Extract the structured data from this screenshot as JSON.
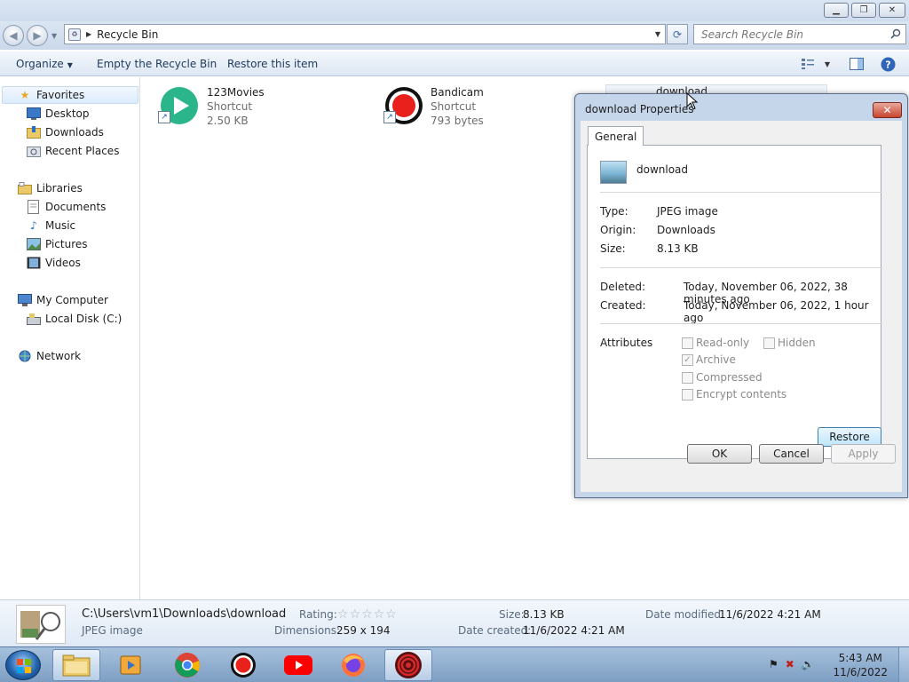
{
  "window": {
    "controls": {
      "minimize": "▁",
      "restore": "❐",
      "close": "✕"
    }
  },
  "address": {
    "path": "Recycle Bin",
    "search_placeholder": "Search Recycle Bin"
  },
  "toolbar": {
    "organize": "Organize",
    "empty": "Empty the Recycle Bin",
    "restore": "Restore this item"
  },
  "nav": {
    "favorites": "Favorites",
    "desktop": "Desktop",
    "downloads": "Downloads",
    "recent": "Recent Places",
    "libraries": "Libraries",
    "documents": "Documents",
    "music": "Music",
    "pictures": "Pictures",
    "videos": "Videos",
    "computer": "My Computer",
    "localdisk": "Local Disk (C:)",
    "network": "Network"
  },
  "files": [
    {
      "name": "123Movies",
      "type": "Shortcut",
      "size": "2.50 KB"
    },
    {
      "name": "Bandicam",
      "type": "Shortcut",
      "size": "793 bytes"
    },
    {
      "name": "download"
    }
  ],
  "dialog": {
    "title": "download Properties",
    "close": "✕",
    "tab": "General",
    "filename": "download",
    "type_label": "Type:",
    "type_value": "JPEG image",
    "origin_label": "Origin:",
    "origin_value": "Downloads",
    "size_label": "Size:",
    "size_value": "8.13 KB",
    "deleted_label": "Deleted:",
    "deleted_value": "Today, November 06, 2022, 38 minutes ago",
    "created_label": "Created:",
    "created_value": "Today, November 06, 2022, 1 hour ago",
    "attributes_label": "Attributes",
    "attr": {
      "readonly": "Read-only",
      "hidden": "Hidden",
      "archive": "Archive",
      "compressed": "Compressed",
      "encrypt": "Encrypt contents"
    },
    "restore": "Restore",
    "ok": "OK",
    "cancel": "Cancel",
    "apply": "Apply"
  },
  "details": {
    "path": "C:\\Users\\vm1\\Downloads\\download",
    "type": "JPEG image",
    "rating_label": "Rating:",
    "rating": 0,
    "dimensions_label": "Dimensions:",
    "dimensions": "259 x 194",
    "size_label": "Size:",
    "size": "8.13 KB",
    "created_label": "Date created:",
    "created": "11/6/2022 4:21 AM",
    "modified_label": "Date modified:",
    "modified": "11/6/2022 4:21 AM"
  },
  "taskbar": {
    "time": "5:43 AM",
    "date": "11/6/2022"
  }
}
